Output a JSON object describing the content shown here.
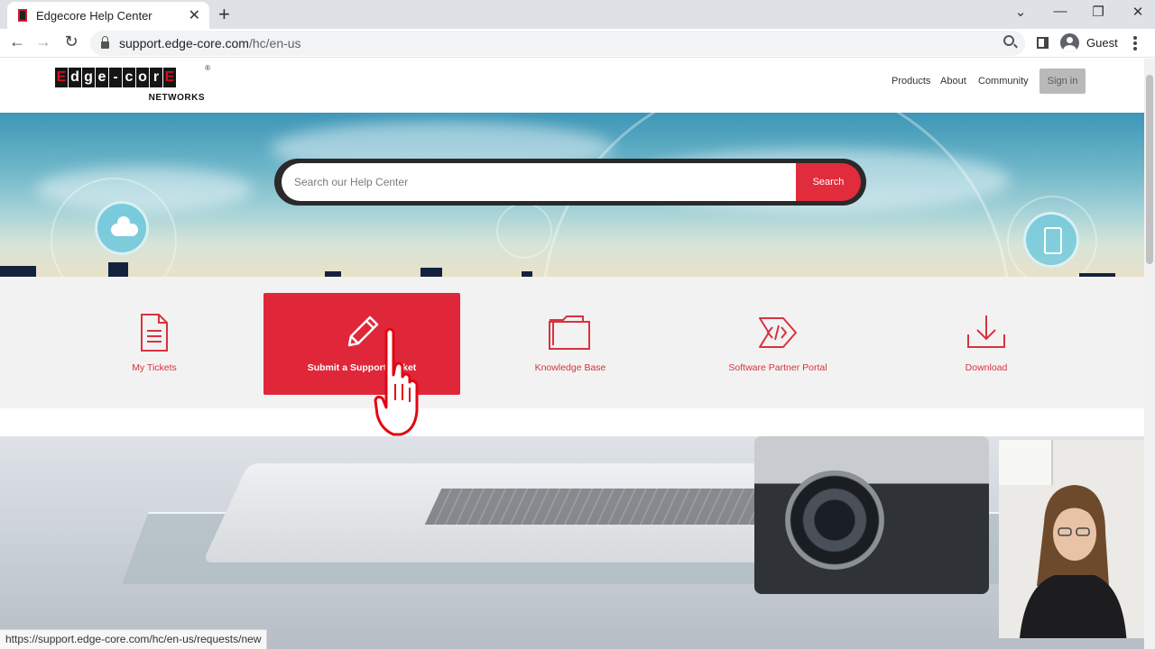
{
  "browser": {
    "tab_title": "Edgecore Help Center",
    "url_host": "support.edge-core.com",
    "url_path": "/hc/en-us",
    "profile_label": "Guest",
    "status_url": "https://support.edge-core.com/hc/en-us/requests/new"
  },
  "header": {
    "logo_letters": [
      "E",
      "d",
      "g",
      "e",
      "-",
      "c",
      "o",
      "r",
      "E"
    ],
    "logo_sub": "NETWORKS",
    "nav": [
      "Products",
      "About",
      "Community"
    ],
    "signin_label": "Sign in"
  },
  "search": {
    "placeholder": "Search our Help Center",
    "button_label": "Search"
  },
  "cards": [
    {
      "label": "My Tickets",
      "icon": "document-icon",
      "active": false
    },
    {
      "label": "Submit a Support Ticket",
      "icon": "pencil-icon",
      "active": true
    },
    {
      "label": "Knowledge Base",
      "icon": "folder-icon",
      "active": false
    },
    {
      "label": "Software Partner Portal",
      "icon": "code-icon",
      "active": false
    },
    {
      "label": "Download",
      "icon": "download-icon",
      "active": false
    }
  ],
  "colors": {
    "brand_red": "#e0273a",
    "label_red": "#d8323f"
  }
}
